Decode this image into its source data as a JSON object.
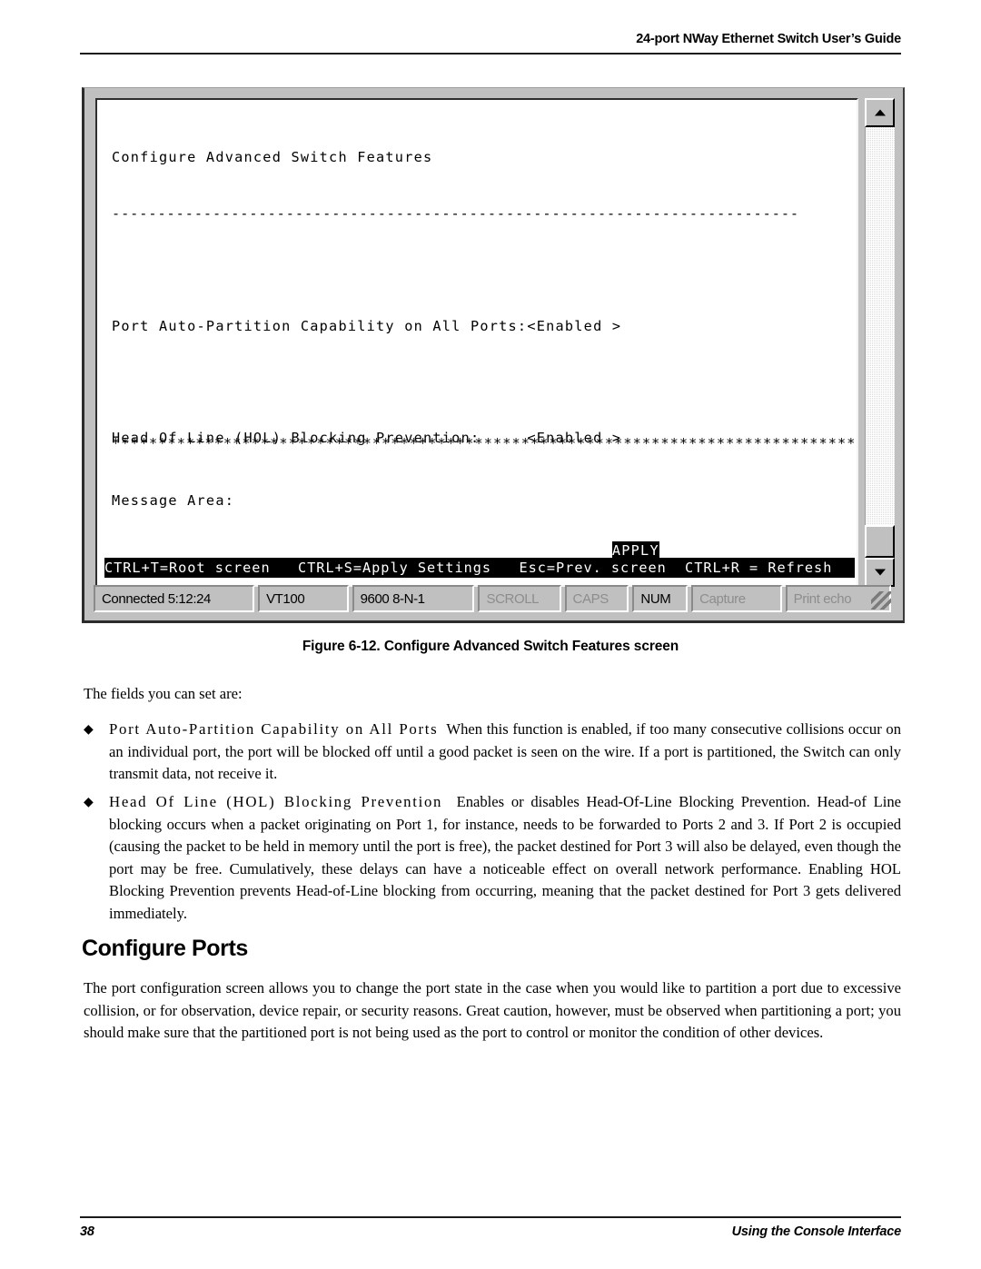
{
  "header": {
    "running_head": "24-port NWay Ethernet Switch User’s Guide"
  },
  "terminal": {
    "title": "Configure Advanced Switch Features",
    "divider": "---------------------------------------------------------------------------",
    "field_auto_partition": "Port Auto-Partition Capability on All Ports:<Enabled >",
    "field_hol": "Head Of Line (HOL) Blocking Prevention:     <Enabled >",
    "apply_button": "APPLY",
    "stars": "************************************************************************************",
    "message_area": "Message Area:",
    "key_bar": "CTRL+T=Root screen   CTRL+S=Apply Settings   Esc=Prev. screen  CTRL+R = Refresh",
    "scrollbar": {
      "up_arrow": "scroll-up-arrow",
      "down_arrow": "scroll-down-arrow"
    }
  },
  "status_bar": {
    "connected": "Connected 5:12:24",
    "emulation": "VT100",
    "line_settings": "9600 8-N-1",
    "scroll": "SCROLL",
    "caps": "CAPS",
    "num": "NUM",
    "capture": "Capture",
    "print_echo": "Print echo"
  },
  "figure": {
    "caption": "Figure 6-12.  Configure Advanced Switch Features screen"
  },
  "content": {
    "intro": "The fields you can set are:",
    "bullets": [
      {
        "lead_in": "Port Auto-Partition Capability on All Ports",
        "body": "When this function is enabled, if too many consecutive collisions occur on an individual port, the port will be blocked off until a good packet is seen on the wire. If a port is partitioned, the Switch can only transmit data, not receive it."
      },
      {
        "lead_in": "Head Of Line (HOL) Blocking Prevention",
        "body": "Enables or disables Head-Of-Line Blocking Prevention. Head-of Line blocking occurs when a packet originating on Port 1, for instance, needs to be forwarded to Ports 2 and 3. If Port 2 is occupied (causing the packet to be held in memory until the port is free), the packet destined for Port 3 will also be delayed, even though the port may be free. Cumulatively, these delays can have a noticeable effect on overall network performance. Enabling HOL Blocking Prevention prevents Head-of-Line blocking from occurring, meaning that the packet destined for Port 3 gets delivered immediately."
      }
    ],
    "section_title": "Configure Ports",
    "section_paragraph": "The port configuration screen allows you to change the port state in the case when you would like to partition a port due to excessive collision, or for observation, device repair, or security reasons. Great caution, however, must be observed when partitioning a port; you should make sure that the partitioned port is not being used as the port to control or monitor the condition of other devices."
  },
  "footer": {
    "page_number": "38",
    "section_label": "Using the Console Interface"
  }
}
